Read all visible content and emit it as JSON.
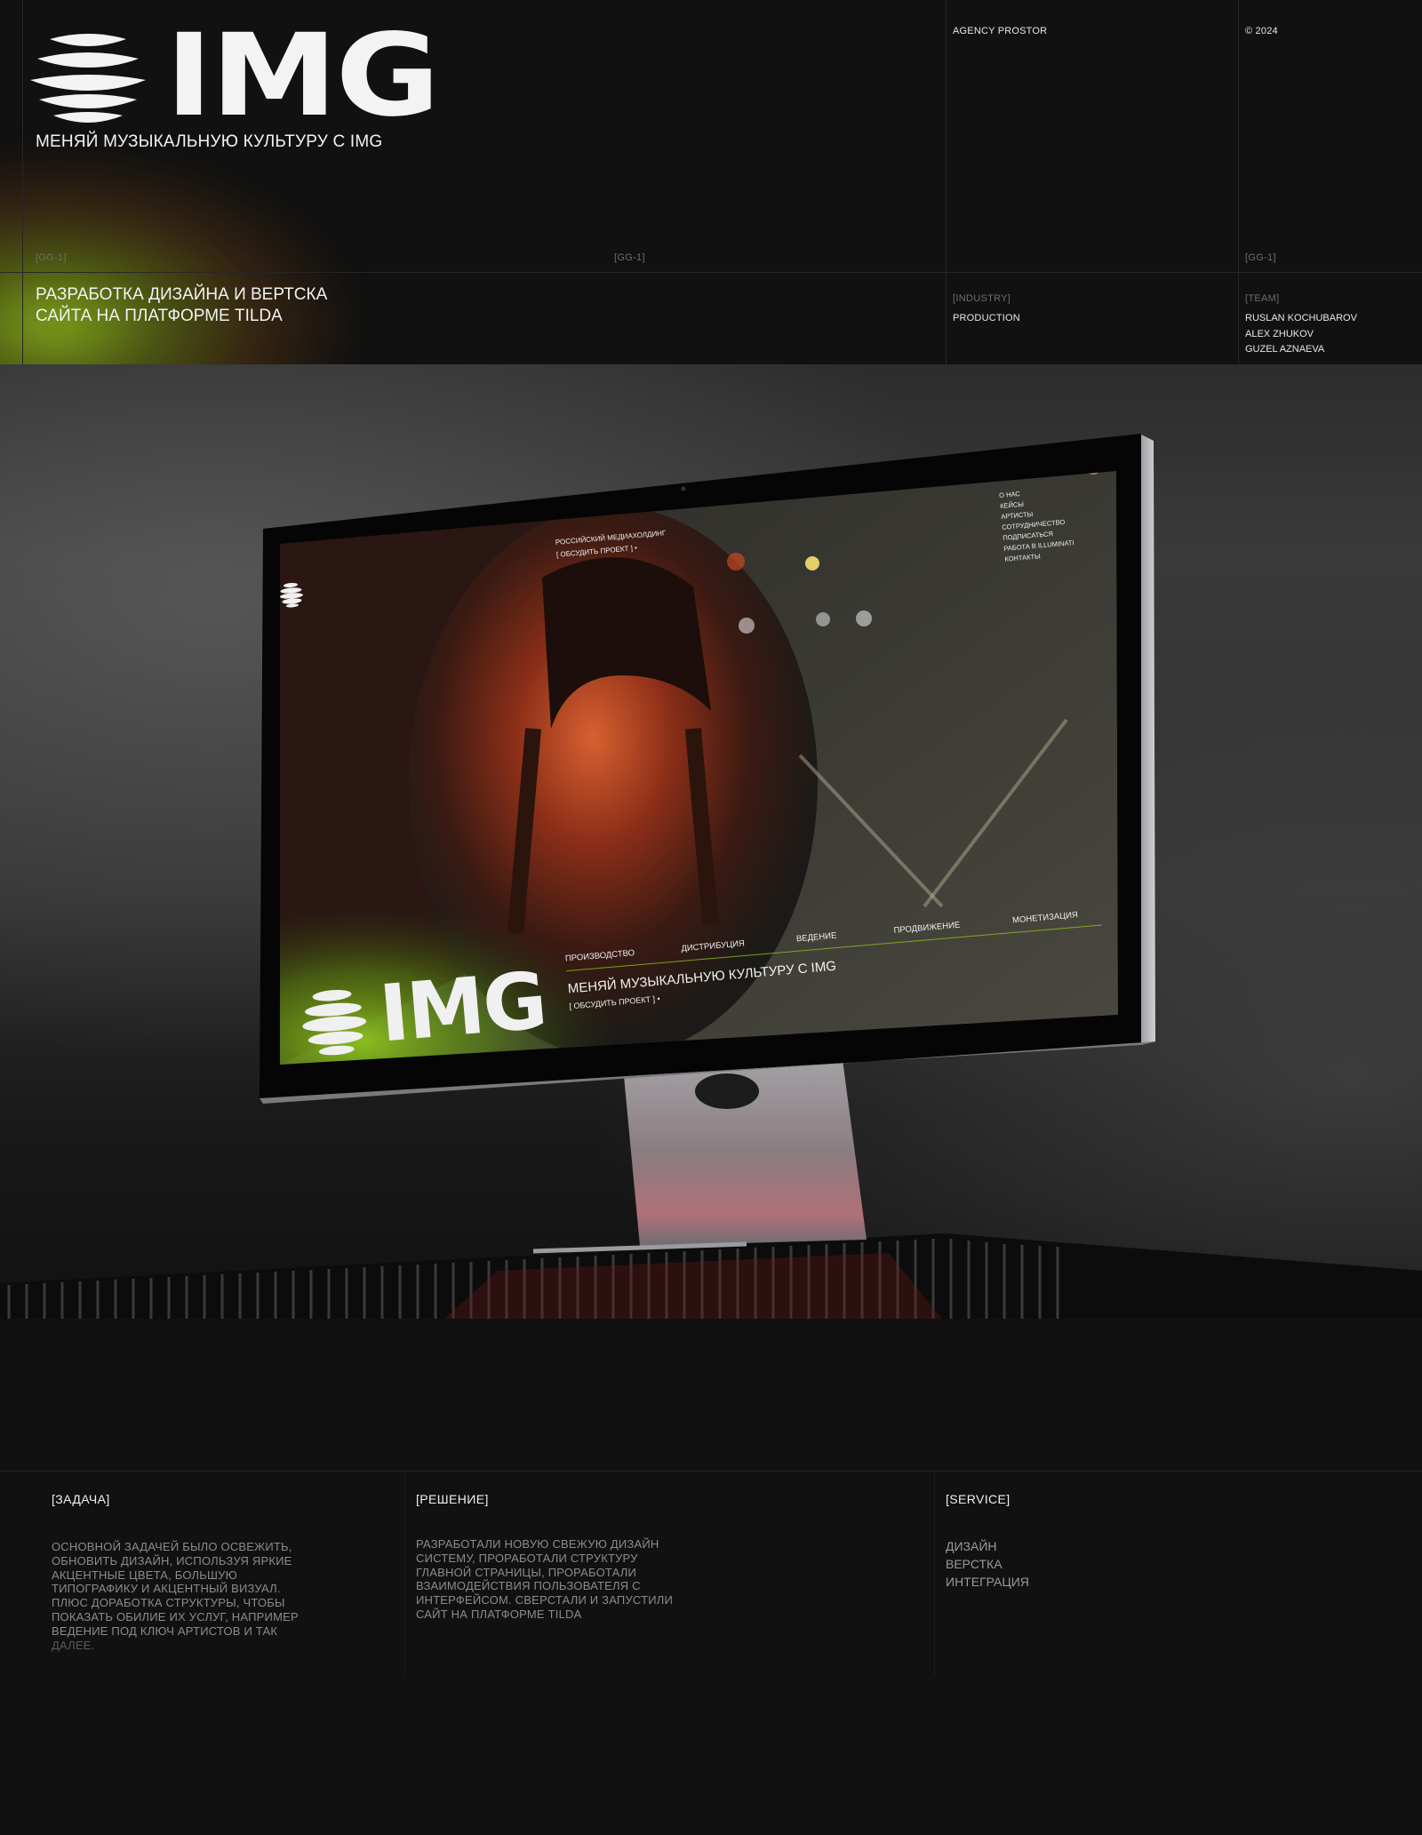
{
  "header": {
    "logo_text": "IMG",
    "tagline": "МЕНЯЙ МУЗЫКАЛЬНУЮ КУЛЬТУРУ С IMG",
    "agency": "AGENCY PROSTOR",
    "year": "© 2024",
    "tags": [
      "[GG-1]",
      "[GG-1]",
      "[GG-1]"
    ],
    "headline_line1": "РАЗРАБОТКА ДИЗАЙНА И ВЕРТСКА",
    "headline_line2": "САЙТА НА ПЛАТФОРМЕ TILDA",
    "industry_label": "[INDUSTRY]",
    "industry_value": "PRODUCTION",
    "team_label": "[TEAM]",
    "team": [
      "RUSLAN KOCHUBAROV",
      "ALEX ZHUKOV",
      "GUZEL AZNAEVA"
    ]
  },
  "screen": {
    "top_line1": "РОССИЙСКИЙ МЕДИАХОЛДИНГ",
    "top_line2": "[ ОБСУДИТЬ ПРОЕКТ ]  •",
    "menu": [
      "О НАС",
      "КЕЙСЫ",
      "АРТИСТЫ",
      "СОТРУДНИЧЕСТВО",
      "ПОДПИСАТЬСЯ",
      "РАБОТА В ILLUMINATI",
      "КОНТАКТЫ"
    ],
    "services": [
      "ПРОИЗВОДСТВО",
      "ДИСТРИБУЦИЯ",
      "ВЕДЕНИЕ",
      "ПРОДВИЖЕНИЕ",
      "МОНЕТИЗАЦИЯ"
    ],
    "logo_text": "IMG",
    "tagline": "МЕНЯЙ МУЗЫКАЛЬНУЮ КУЛЬТУРУ С IMG",
    "cta": "[ ОБСУДИТЬ ПРОЕКТ ]  •"
  },
  "task": {
    "title": "[ЗАДАЧА]",
    "lines": [
      "ОСНОВНОЙ ЗАДАЧЕЙ БЫЛО ОСВЕЖИТЬ,",
      "ОБНОВИТЬ ДИЗАЙН, ИСПОЛЬЗУЯ ЯРКИЕ",
      "АКЦЕНТНЫЕ ЦВЕТА, БОЛЬШУЮ",
      "ТИПОГРАФИКУ И АКЦЕНТНЫЙ ВИЗУАЛ.",
      "ПЛЮС ДОРАБОТКА СТРУКТУРЫ, ЧТОБЫ",
      "ПОКАЗАТЬ ОБИЛИЕ ИХ УСЛУГ, НАПРИМЕР",
      "ВЕДЕНИЕ ПОД КЛЮЧ АРТИСТОВ И ТАК",
      "ДАЛЕЕ."
    ]
  },
  "solution": {
    "title": "[РЕШЕНИЕ]",
    "lines": [
      "РАЗРАБОТАЛИ НОВУЮ СВЕЖУЮ ДИЗАЙН",
      "СИСТЕМУ, ПРОРАБОТАЛИ СТРУКТУРУ",
      "ГЛАВНОЙ СТРАНИЦЫ, ПРОРАБОТАЛИ",
      "ВЗАИМОДЕЙСТВИЯ ПОЛЬЗОВАТЕЛЯ С",
      "ИНТЕРФЕЙСОМ. СВЕРСТАЛИ И ЗАПУСТИЛИ",
      "САЙТ НА ПЛАТФОРМЕ TILDA"
    ]
  },
  "service": {
    "title": "[SERVICE]",
    "items": [
      "ДИЗАЙН",
      "ВЕРСТКА",
      "ИНТЕГРАЦИЯ"
    ]
  },
  "colors": {
    "background": "#0f0f0f",
    "accent_green": "#8fc41e",
    "accent_orange": "#e05020"
  }
}
